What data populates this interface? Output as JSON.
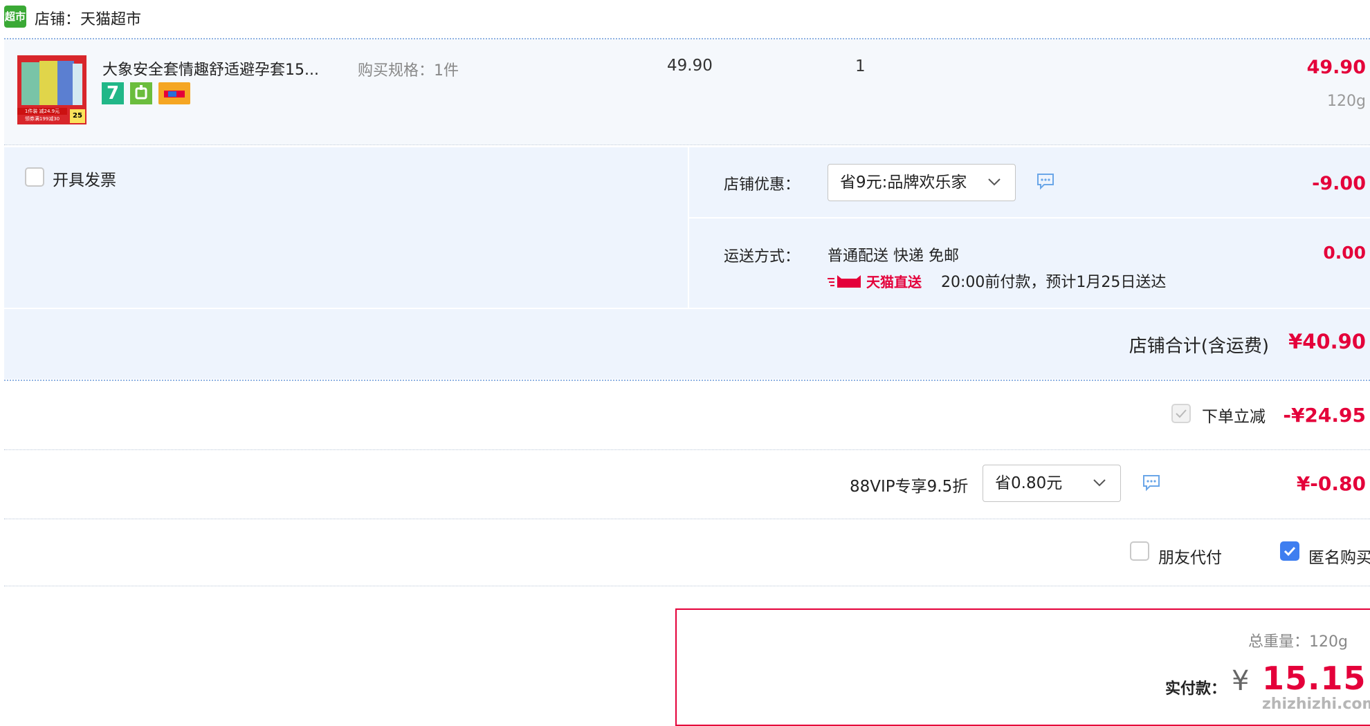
{
  "shop": {
    "badge_text": "超市",
    "title": "店铺：天猫超市"
  },
  "item": {
    "name": "大象安全套情趣舒适避孕套15...",
    "spec": "购买规格：1件",
    "unit_price": "49.90",
    "quantity": "1",
    "total": "49.90",
    "weight": "120g",
    "thumb_text_1": "1件装 减24.9元",
    "thumb_text_2": "领券满199减30",
    "thumb_badge": "25",
    "badges": [
      "7-day-return-icon",
      "guarantee-icon",
      "card-icon"
    ]
  },
  "invoice": {
    "label": "开具发票"
  },
  "shop_coupon": {
    "label": "店铺优惠：",
    "selected": "省9元:品牌欢乐家",
    "amount": "-9.00"
  },
  "shipping": {
    "label": "运送方式：",
    "method": "普通配送 快递 免邮",
    "tmall_direct": "天猫直送",
    "eta": "20:00前付款，预计1月25日送达",
    "amount": "0.00"
  },
  "shop_total": {
    "label": "店铺合计(含运费)",
    "amount": "¥40.90"
  },
  "instant_discount": {
    "label": "下单立减",
    "amount": "-¥24.95"
  },
  "vip": {
    "label": "88VIP专享9.5折",
    "selected": "省0.80元",
    "amount": "¥-0.80"
  },
  "options": {
    "friend_pay": "朋友代付",
    "anonymous": "匿名购买"
  },
  "summary": {
    "weight": "总重量：120g",
    "pay_label": "实付款：",
    "currency": "¥",
    "amount": "15.15",
    "watermark": "zhizhizhi.com"
  },
  "colors": {
    "accent_red": "#e4003a",
    "panel_blue": "#eef4fd",
    "checkbox_blue": "#3e7ef0",
    "shop_icon_green": "#3aa935"
  }
}
